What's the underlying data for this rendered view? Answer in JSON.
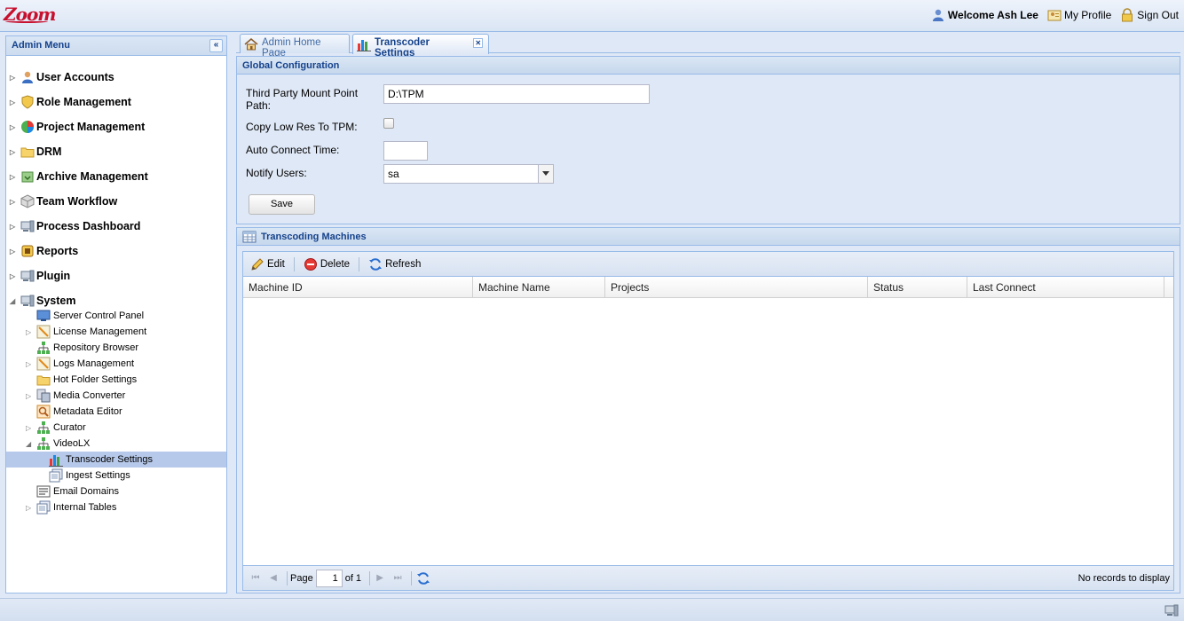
{
  "app": {
    "logo_text": "Zoom"
  },
  "header": {
    "welcome": "Welcome Ash Lee",
    "my_profile": "My Profile",
    "sign_out": "Sign Out"
  },
  "admin_menu": {
    "title": "Admin Menu",
    "collapse_glyph": "«",
    "items": [
      {
        "label": "User Accounts",
        "icon": "user-icon"
      },
      {
        "label": "Role Management",
        "icon": "shield-icon"
      },
      {
        "label": "Project Management",
        "icon": "pie-chart-icon"
      },
      {
        "label": "DRM",
        "icon": "folder-icon"
      },
      {
        "label": "Archive Management",
        "icon": "archive-icon"
      },
      {
        "label": "Team Workflow",
        "icon": "cube-icon"
      },
      {
        "label": "Process Dashboard",
        "icon": "server-icon"
      },
      {
        "label": "Reports",
        "icon": "report-icon"
      },
      {
        "label": "Plugin",
        "icon": "plugin-icon"
      },
      {
        "label": "System",
        "icon": "server-icon"
      }
    ],
    "system_children": [
      {
        "label": "Server Control Panel",
        "icon": "monitor-icon"
      },
      {
        "label": "License Management",
        "icon": "pen-icon"
      },
      {
        "label": "Repository Browser",
        "icon": "hierarchy-icon"
      },
      {
        "label": "Logs Management",
        "icon": "pen-icon"
      },
      {
        "label": "Hot Folder Settings",
        "icon": "folder-icon"
      },
      {
        "label": "Media Converter",
        "icon": "convert-icon"
      },
      {
        "label": "Metadata Editor",
        "icon": "metadata-icon"
      },
      {
        "label": "Curator",
        "icon": "hierarchy-icon"
      },
      {
        "label": "VideoLX",
        "icon": "hierarchy-icon"
      },
      {
        "label": "Email Domains",
        "icon": "list-icon"
      },
      {
        "label": "Internal Tables",
        "icon": "pages-icon"
      }
    ],
    "videolx_children": [
      {
        "label": "Transcoder Settings",
        "icon": "bar-chart-icon"
      },
      {
        "label": "Ingest Settings",
        "icon": "pages-icon"
      }
    ]
  },
  "tabs": [
    {
      "label": "Admin Home Page",
      "icon": "home-icon"
    },
    {
      "label": "Transcoder Settings",
      "icon": "bar-chart-icon"
    }
  ],
  "global_config": {
    "title": "Global Configuration",
    "mount_label": "Third Party Mount Point Path:",
    "mount_value": "D:\\TPM",
    "copy_low_res_label": "Copy Low Res To TPM:",
    "copy_low_res_checked": false,
    "auto_connect_label": "Auto Connect Time:",
    "auto_connect_value": "",
    "notify_label": "Notify Users:",
    "notify_value": "sa",
    "save_label": "Save"
  },
  "machines": {
    "title": "Transcoding Machines",
    "toolbar": {
      "edit": "Edit",
      "delete": "Delete",
      "refresh": "Refresh"
    },
    "columns": [
      "Machine ID",
      "Machine Name",
      "Projects",
      "Status",
      "Last Connect"
    ],
    "rows": [],
    "pager": {
      "page_label": "Page",
      "page_value": "1",
      "of_label": "of 1",
      "no_records": "No records to display"
    }
  },
  "colors": {
    "accent": "#15428b",
    "border": "#99bbe8",
    "selected": "#b7c9ea",
    "logo": "#c8102e"
  }
}
